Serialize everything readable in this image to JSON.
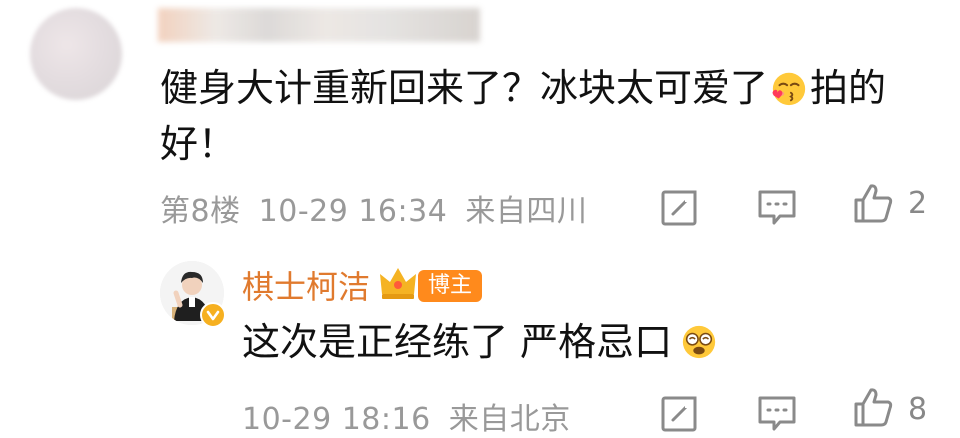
{
  "comment": {
    "text_line1": "健身大计重新回来了？冰块太可爱了",
    "text_after_emoji": "拍的",
    "text_line2": "好！",
    "emoji": "kiss-face-emoji",
    "floor": "第8楼",
    "time": "10-29 16:34",
    "location": "来自四川",
    "like_count": "2"
  },
  "reply": {
    "author": "棋士柯洁",
    "badge": "博主",
    "text": "这次是正经练了 严格忌口",
    "emoji": "dizzy-face-emoji",
    "time": "10-29 18:16",
    "location": "来自北京",
    "like_count": "8"
  },
  "colors": {
    "author_name": "#e07a2e",
    "badge_bg": "#ff8a1c",
    "meta": "#999999"
  }
}
